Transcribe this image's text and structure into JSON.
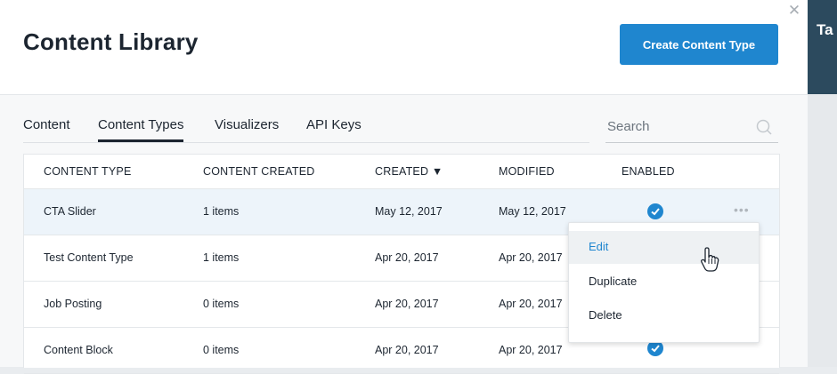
{
  "app": {
    "title": "Content Library",
    "backdrop_text": "Ta"
  },
  "header": {
    "create_button_label": "Create Content Type",
    "close_icon": "close-icon",
    "accent_color": "#1f86cf"
  },
  "tabs": [
    {
      "label": "Content",
      "active": false
    },
    {
      "label": "Content Types",
      "active": true
    },
    {
      "label": "Visualizers",
      "active": false
    },
    {
      "label": "API Keys",
      "active": false
    }
  ],
  "search": {
    "placeholder": "Search",
    "icon": "search-icon"
  },
  "table": {
    "columns": [
      "CONTENT TYPE",
      "CONTENT CREATED",
      "CREATED",
      "MODIFIED",
      "ENABLED"
    ],
    "sort_indicator": "▼",
    "rows": [
      {
        "name": "CTA Slider",
        "created_count": "1 items",
        "created": "May 12, 2017",
        "modified": "May 12, 2017",
        "enabled": true
      },
      {
        "name": "Test Content Type",
        "created_count": "1 items",
        "created": "Apr 20, 2017",
        "modified": "Apr 20, 2017",
        "enabled": true
      },
      {
        "name": "Job Posting",
        "created_count": "0 items",
        "created": "Apr 20, 2017",
        "modified": "Apr 20, 2017",
        "enabled": true
      },
      {
        "name": "Content Block",
        "created_count": "0 items",
        "created": "Apr 20, 2017",
        "modified": "Apr 20, 2017",
        "enabled": true
      }
    ]
  },
  "context_menu": {
    "items": [
      "Edit",
      "Duplicate",
      "Delete"
    ],
    "hovered": "Edit"
  },
  "row_actions_icon": "more-horizontal-icon"
}
